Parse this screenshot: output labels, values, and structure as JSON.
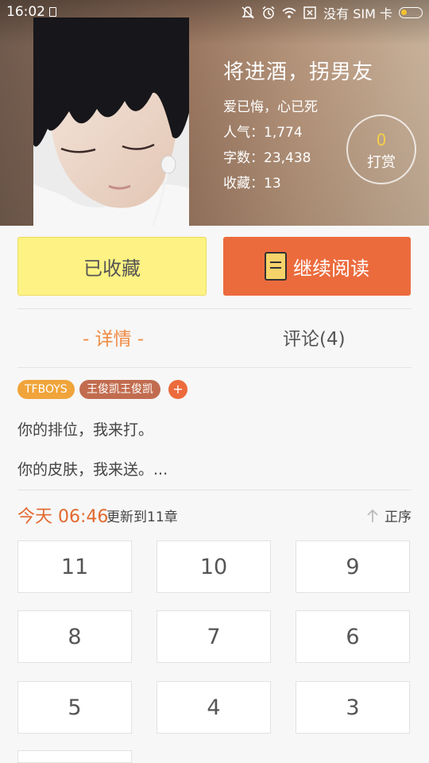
{
  "status_bar": {
    "time": "16:02",
    "carrier": "没有 SIM 卡",
    "icons": [
      "notification-icon",
      "mute-icon",
      "alarm-icon",
      "wifi-icon",
      "no-sim-icon",
      "battery-icon"
    ]
  },
  "book": {
    "title": "将进酒，拐男友",
    "subtitle": "爱已悔，心已死",
    "popularity": "人气：1,774",
    "word_count": "字数：23,438",
    "favorites": "收藏：13"
  },
  "reward": {
    "count": "0",
    "label": "打赏"
  },
  "actions": {
    "favorited_label": "已收藏",
    "continue_label": "继续阅读"
  },
  "tabs": [
    {
      "label": "- 详情 -",
      "active": true
    },
    {
      "label": "评论(4)",
      "active": false
    }
  ],
  "tags": [
    "TFBOYS",
    "王俊凯王俊凯"
  ],
  "tag_add": "+",
  "description": [
    "你的排位，我来打。",
    "你的皮肤，我来送。..."
  ],
  "update": {
    "time": "今天 06:46",
    "text": "更新到11章",
    "sort_label": "正序"
  },
  "chapters": [
    "11",
    "10",
    "9",
    "8",
    "7",
    "6",
    "5",
    "4",
    "3"
  ],
  "colors": {
    "accent": "#ec6b3d",
    "favorite_bg": "#fdf283",
    "tab_active": "#f08b45",
    "reward_count": "#f5cf4a"
  }
}
